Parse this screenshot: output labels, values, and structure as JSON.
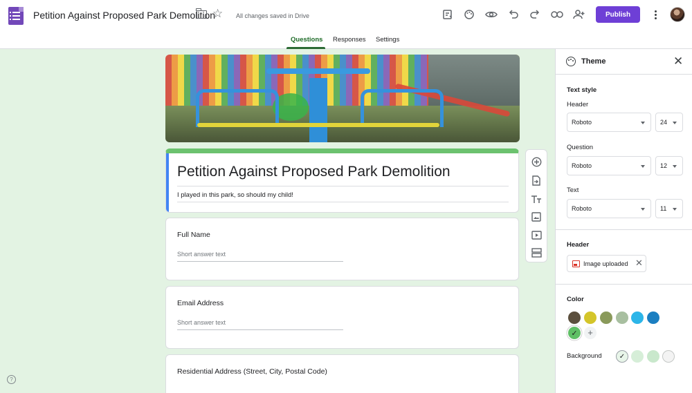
{
  "app": {
    "doc_title": "Petition Against Proposed Park Demolition",
    "save_status": "All changes saved in Drive",
    "publish_label": "Publish",
    "toolbar_icons": [
      "addon-icon",
      "palette-icon",
      "preview-eye-icon",
      "undo-icon",
      "redo-icon",
      "link-icon",
      "add-collaborator-icon"
    ]
  },
  "tabs": [
    {
      "label": "Questions",
      "active": true
    },
    {
      "label": "Responses",
      "active": false
    },
    {
      "label": "Settings",
      "active": false
    }
  ],
  "form": {
    "title": "Petition Against Proposed Park Demolition",
    "description": "I played in this park, so should my child!",
    "questions": [
      {
        "title": "Full Name",
        "answer_placeholder": "Short answer text"
      },
      {
        "title": "Email Address",
        "answer_placeholder": "Short answer text"
      },
      {
        "title": "Residential Address (Street, City, Postal Code)"
      }
    ]
  },
  "side_toolbar": [
    "add-question-icon",
    "import-questions-icon",
    "add-title-icon",
    "add-image-icon",
    "add-video-icon",
    "add-section-icon"
  ],
  "theme_panel": {
    "title": "Theme",
    "text_style_label": "Text style",
    "header_label": "Header",
    "header_font": "Roboto",
    "header_size": "24",
    "question_label": "Question",
    "question_font": "Roboto",
    "question_size": "12",
    "text_label": "Text",
    "text_font": "Roboto",
    "text_size": "11",
    "header_image_label": "Header",
    "header_image_chip": "Image uploaded",
    "color_label": "Color",
    "background_label": "Background",
    "colors": [
      "#5b4f3d",
      "#d4c52a",
      "#8a9a5b",
      "#a8bfa0",
      "#2cb5e8",
      "#1b7fc1",
      "#5fbf65"
    ],
    "selected_color": "#5fbf65",
    "backgrounds": [
      "#e8f5e9",
      "#d6eed8",
      "#c9e8cc",
      "#f3f3f3"
    ],
    "selected_background": "#e8f5e9"
  }
}
